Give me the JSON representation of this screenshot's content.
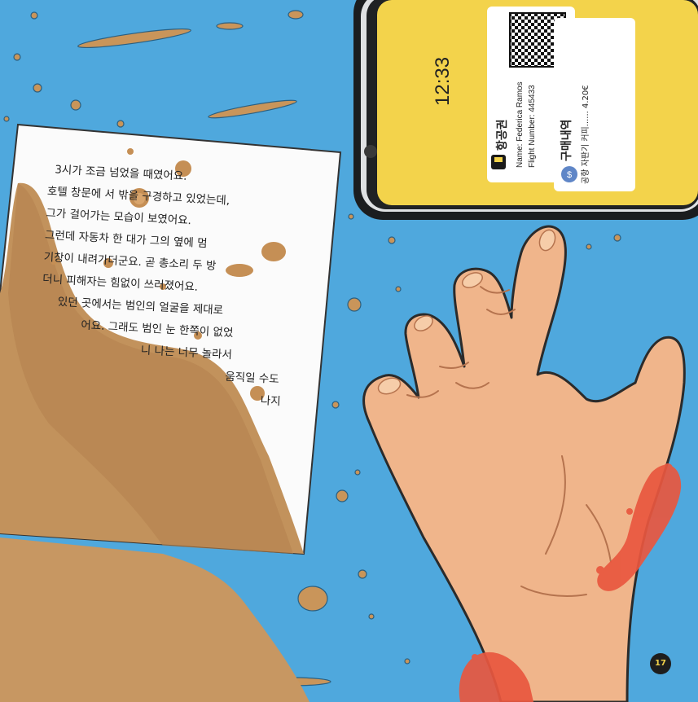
{
  "note": {
    "lines": [
      "3시가 조금 넘었을 때였어요.",
      "호텔 창문에 서 밖을 구경하고 있었는데,",
      "그가 걸어가는 모습이 보였어요.",
      "그런데 자동차 한 대가 그의 옆에 멈",
      "기창이 내려가더군요. 곧 총소리 두 방",
      "더니 피해자는 힘없이 쓰러졌어요.",
      "있던 곳에서는 범인의 얼굴을 제대로",
      "어요. 그래도 범인 눈 한쪽이 없었",
      "니 나는 너무 놀라서",
      "움직일 수도",
      "나지"
    ]
  },
  "phone": {
    "time": "12:33",
    "ticket": {
      "title": "항공권",
      "name_line": "Name: Federica Ramos",
      "flight_line": "Flight Number: 445433"
    },
    "purchase": {
      "title": "구매내역",
      "item_line": "공항 자판기 커피...... 4.20€"
    }
  },
  "page_number": "17",
  "colors": {
    "background": "#4fa8dd",
    "coffee": "#c9955a",
    "phone_screen": "#f3d34b",
    "skin": "#f0b58b",
    "blood": "#e9573f"
  }
}
